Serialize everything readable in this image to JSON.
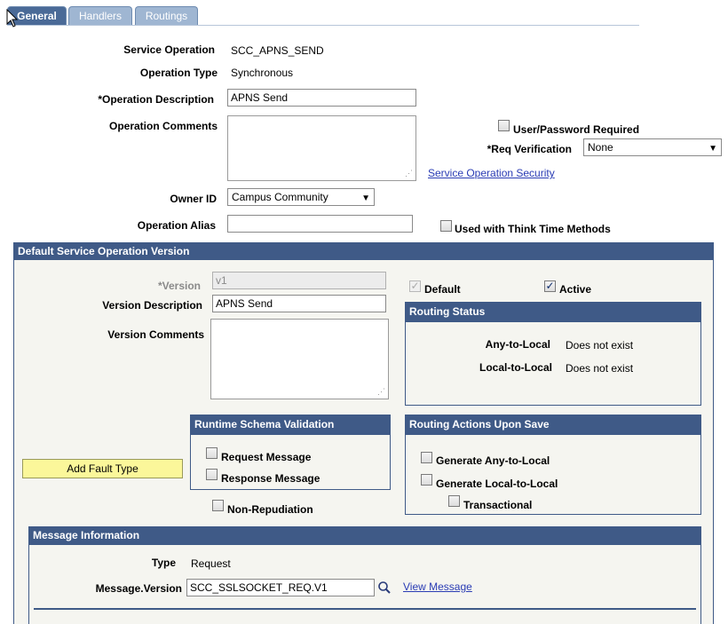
{
  "tabs": [
    {
      "label": "General"
    },
    {
      "label": "Handlers"
    },
    {
      "label": "Routings"
    }
  ],
  "general": {
    "service_operation_label": "Service Operation",
    "service_operation_value": "SCC_APNS_SEND",
    "operation_type_label": "Operation Type",
    "operation_type_value": "Synchronous",
    "operation_description_label": "*Operation Description",
    "operation_description_value": "APNS Send",
    "operation_comments_label": "Operation Comments",
    "user_password_label": "User/Password Required",
    "req_verification_label": "*Req Verification",
    "req_verification_value": "None",
    "security_link": "Service Operation Security",
    "owner_id_label": "Owner ID",
    "owner_id_value": "Campus Community",
    "operation_alias_label": "Operation Alias",
    "operation_alias_value": "",
    "think_time_label": "Used with Think Time Methods"
  },
  "version_panel": {
    "title": "Default Service Operation Version",
    "version_label": "*Version",
    "version_value": "v1",
    "default_label": "Default",
    "active_label": "Active",
    "version_description_label": "Version Description",
    "version_description_value": "APNS Send",
    "version_comments_label": "Version Comments",
    "routing_status": {
      "title": "Routing Status",
      "any_to_local_label": "Any-to-Local",
      "any_to_local_value": "Does not exist",
      "local_to_local_label": "Local-to-Local",
      "local_to_local_value": "Does not exist"
    },
    "schema_validation": {
      "title": "Runtime Schema Validation",
      "request_label": "Request Message",
      "response_label": "Response Message"
    },
    "routing_actions": {
      "title": "Routing Actions Upon Save",
      "any_to_local_label": "Generate Any-to-Local",
      "local_to_local_label": "Generate Local-to-Local",
      "transactional_label": "Transactional"
    },
    "add_fault_label": "Add Fault Type",
    "non_repudiation_label": "Non-Repudiation"
  },
  "message_info": {
    "title": "Message Information",
    "type_label": "Type",
    "type_value": "Request",
    "message_version_label": "Message.Version",
    "message_version_value": "SCC_SSLSOCKET_REQ.V1",
    "view_message_link": "View Message"
  },
  "colors": {
    "panel_header": "#3f5a87",
    "tab_active": "#4a6a97",
    "tab_inactive": "#9fb6d2",
    "button_yellow": "#fbf79a",
    "link": "#2a3cb4"
  }
}
